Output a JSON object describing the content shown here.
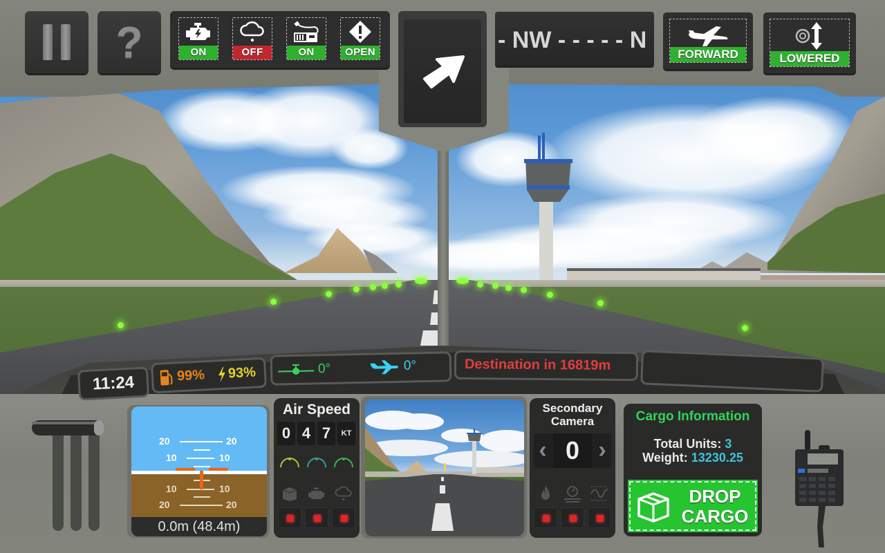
{
  "top_bar": {
    "pause_icon": "pause-icon",
    "help_label": "?",
    "status_toggles": [
      {
        "icon": "engine-icon",
        "label": "ON",
        "state_color": "#2fb12f"
      },
      {
        "icon": "rain-cloud-icon",
        "label": "OFF",
        "state_color": "#c1272d"
      },
      {
        "icon": "radio-device-icon",
        "label": "ON",
        "state_color": "#2fb12f"
      },
      {
        "icon": "warning-diamond-icon",
        "label": "OPEN",
        "state_color": "#2fb12f"
      }
    ],
    "direction_arrow": "arrow-up-right-icon",
    "compass_strip": "- NW - - - - - N",
    "flight_mode": {
      "icon": "airplane-icon",
      "label": "FORWARD"
    },
    "landing_gear": {
      "icon": "wheel-up-down-icon",
      "label": "LOWERED"
    }
  },
  "dashboard": {
    "clock": "11:24",
    "fuel": {
      "icon": "fuel-pump-icon",
      "value": "99%"
    },
    "battery": {
      "icon": "lightning-icon",
      "value": "93%"
    },
    "pitch": {
      "icon": "pitch-indicator-icon",
      "value": "0°"
    },
    "roll": {
      "icon": "airplane-heading-icon",
      "value": "0°"
    },
    "destination": "Destination in 16819m",
    "blank_pill": ""
  },
  "attitude_indicator": {
    "pitch_labels_up": [
      "20",
      "10"
    ],
    "pitch_labels_down": [
      "10",
      "20"
    ],
    "altitude_readout": "0.0m (48.4m)"
  },
  "airspeed": {
    "title": "Air Speed",
    "digits": [
      "0",
      "4",
      "7"
    ],
    "unit": "KT",
    "gauge_colors": [
      "#b6c42c",
      "#3f9c98",
      "#39b44a"
    ],
    "system_icons": [
      "cargo-box-icon",
      "engine-icon",
      "rain-cloud-icon"
    ],
    "indicators": [
      "off",
      "off",
      "off"
    ]
  },
  "secondary_camera": {
    "title_line1": "Secondary",
    "title_line2": "Camera",
    "value": "0",
    "prev_label": "‹",
    "next_label": "›",
    "system_icons": [
      "fire-icon",
      "pressure-gauge-icon",
      "waveform-icon"
    ],
    "indicators": [
      "off",
      "off",
      "off"
    ]
  },
  "cargo": {
    "title": "Cargo Information",
    "units_label": "Total Units: ",
    "units_value": "3",
    "weight_label": "Weight: ",
    "weight_value": "13230.25",
    "drop_line1": "DROP",
    "drop_line2": "CARGO",
    "drop_icon": "cargo-box-icon"
  },
  "colors": {
    "accent_green": "#2fb12f",
    "alert_red": "#e23d3d",
    "fuel_orange": "#e8851a",
    "battery_yellow": "#e3d22a",
    "pitch_green": "#3fd05b",
    "roll_cyan": "#39d3ee"
  }
}
